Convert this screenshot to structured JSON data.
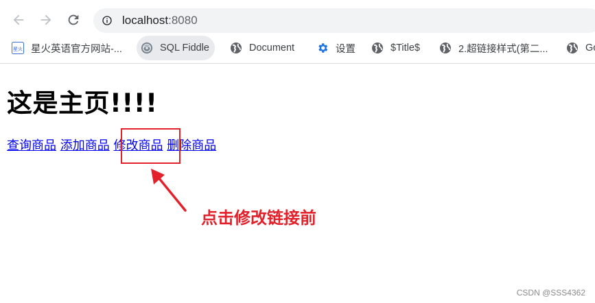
{
  "browser": {
    "address_host": "localhost",
    "address_port": ":8080"
  },
  "bookmarks": [
    {
      "label": "星火英语官方网站-...",
      "icon": "xinghuo-logo-icon"
    },
    {
      "label": "SQL Fiddle",
      "icon": "sql-fiddle-icon"
    },
    {
      "label": "Document",
      "icon": "globe-icon"
    },
    {
      "label": "设置",
      "icon": "gear-icon"
    },
    {
      "label": "$Title$",
      "icon": "globe-icon"
    },
    {
      "label": "2.超链接样式(第二...",
      "icon": "globe-icon"
    },
    {
      "label": "Go",
      "icon": "globe-icon"
    }
  ],
  "page": {
    "heading": "这是主页!!!!",
    "links": [
      "查询商品",
      "添加商品",
      "修改商品",
      "删除商品"
    ]
  },
  "annotation": {
    "text": "点击修改链接前",
    "color": "#e3212b"
  },
  "watermark": "CSDN @SSS4362",
  "colors": {
    "link": "#0000ee",
    "annotation_red": "#e3212b",
    "omnibox_bg": "#f1f3f4"
  }
}
